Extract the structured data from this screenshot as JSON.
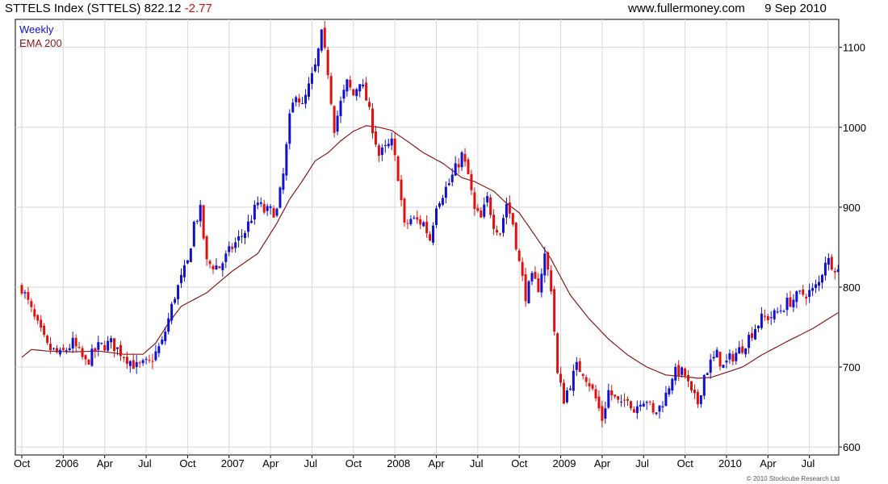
{
  "header": {
    "title": "STTELS Index (STTELS)",
    "last": "822.12",
    "change": "-2.77",
    "site": "www.fullermoney.com",
    "date": "9 Sep 2010"
  },
  "legend": {
    "weekly": "Weekly",
    "ema": "EMA 200"
  },
  "copyright": "© 2010 Stockcube Research Ltd",
  "colors": {
    "up": "#1010d0",
    "down": "#e01010",
    "ema": "#8b1a1a",
    "grid": "#d8d8d8",
    "header_change": "#d01010"
  },
  "chart_data": {
    "type": "line",
    "title": "STTELS Index (STTELS)",
    "frequency": "Weekly",
    "ylim": [
      590,
      1135
    ],
    "grid": true,
    "y_axis_position": "right",
    "yticks": [
      600,
      700,
      800,
      900,
      1000,
      1100
    ],
    "ytick_labels": [
      "600",
      "700",
      "800",
      "900",
      "1000",
      "1100"
    ],
    "xticks": [
      {
        "label": "Oct",
        "week": 0
      },
      {
        "label": "2006",
        "week": 13
      },
      {
        "label": "Apr",
        "week": 26
      },
      {
        "label": "Jul",
        "week": 39
      },
      {
        "label": "Oct",
        "week": 52
      },
      {
        "label": "2007",
        "week": 65
      },
      {
        "label": "Apr",
        "week": 78
      },
      {
        "label": "Jul",
        "week": 91
      },
      {
        "label": "Oct",
        "week": 104
      },
      {
        "label": "2008",
        "week": 117
      },
      {
        "label": "Apr",
        "week": 130
      },
      {
        "label": "Jul",
        "week": 143
      },
      {
        "label": "Oct",
        "week": 156
      },
      {
        "label": "2009",
        "week": 169
      },
      {
        "label": "Apr",
        "week": 182
      },
      {
        "label": "Jul",
        "week": 195
      },
      {
        "label": "Oct",
        "week": 208
      },
      {
        "label": "2010",
        "week": 221
      },
      {
        "label": "Apr",
        "week": 234
      },
      {
        "label": "Jul",
        "week": 247
      }
    ],
    "week_count": 256,
    "price_keypoints": [
      [
        0,
        800
      ],
      [
        4,
        760
      ],
      [
        8,
        725
      ],
      [
        12,
        715
      ],
      [
        16,
        730
      ],
      [
        20,
        705
      ],
      [
        24,
        725
      ],
      [
        28,
        730
      ],
      [
        32,
        715
      ],
      [
        36,
        700
      ],
      [
        40,
        705
      ],
      [
        44,
        730
      ],
      [
        48,
        790
      ],
      [
        52,
        830
      ],
      [
        54,
        880
      ],
      [
        56,
        895
      ],
      [
        58,
        830
      ],
      [
        62,
        825
      ],
      [
        66,
        850
      ],
      [
        70,
        870
      ],
      [
        74,
        905
      ],
      [
        76,
        895
      ],
      [
        80,
        895
      ],
      [
        82,
        940
      ],
      [
        84,
        1010
      ],
      [
        86,
        1045
      ],
      [
        88,
        1025
      ],
      [
        90,
        1050
      ],
      [
        92,
        1075
      ],
      [
        94,
        1115
      ],
      [
        96,
        1070
      ],
      [
        98,
        1000
      ],
      [
        100,
        1030
      ],
      [
        102,
        1055
      ],
      [
        104,
        1040
      ],
      [
        106,
        1060
      ],
      [
        108,
        1035
      ],
      [
        110,
        1000
      ],
      [
        112,
        965
      ],
      [
        116,
        980
      ],
      [
        118,
        940
      ],
      [
        120,
        875
      ],
      [
        122,
        885
      ],
      [
        126,
        880
      ],
      [
        128,
        860
      ],
      [
        130,
        905
      ],
      [
        134,
        930
      ],
      [
        138,
        965
      ],
      [
        140,
        940
      ],
      [
        142,
        895
      ],
      [
        144,
        885
      ],
      [
        146,
        910
      ],
      [
        148,
        880
      ],
      [
        150,
        870
      ],
      [
        152,
        905
      ],
      [
        154,
        880
      ],
      [
        156,
        830
      ],
      [
        158,
        790
      ],
      [
        160,
        810
      ],
      [
        162,
        800
      ],
      [
        164,
        840
      ],
      [
        166,
        800
      ],
      [
        168,
        690
      ],
      [
        170,
        660
      ],
      [
        172,
        680
      ],
      [
        174,
        700
      ],
      [
        176,
        695
      ],
      [
        178,
        680
      ],
      [
        180,
        660
      ],
      [
        182,
        635
      ],
      [
        184,
        670
      ],
      [
        186,
        660
      ],
      [
        188,
        650
      ],
      [
        190,
        665
      ],
      [
        192,
        645
      ],
      [
        194,
        660
      ],
      [
        196,
        660
      ],
      [
        198,
        640
      ],
      [
        200,
        650
      ],
      [
        202,
        665
      ],
      [
        204,
        690
      ],
      [
        206,
        695
      ],
      [
        208,
        690
      ],
      [
        210,
        665
      ],
      [
        212,
        655
      ],
      [
        214,
        690
      ],
      [
        216,
        705
      ],
      [
        218,
        715
      ],
      [
        220,
        700
      ],
      [
        222,
        710
      ],
      [
        226,
        725
      ],
      [
        230,
        750
      ],
      [
        232,
        760
      ],
      [
        236,
        765
      ],
      [
        240,
        780
      ],
      [
        244,
        790
      ],
      [
        248,
        795
      ],
      [
        250,
        805
      ],
      [
        252,
        835
      ],
      [
        254,
        830
      ],
      [
        256,
        822.12
      ]
    ],
    "ema_keypoints": [
      [
        0,
        712
      ],
      [
        3,
        722
      ],
      [
        8,
        720
      ],
      [
        16,
        719
      ],
      [
        24,
        720
      ],
      [
        32,
        716
      ],
      [
        38,
        716
      ],
      [
        42,
        730
      ],
      [
        46,
        755
      ],
      [
        50,
        776
      ],
      [
        58,
        793
      ],
      [
        66,
        820
      ],
      [
        74,
        842
      ],
      [
        80,
        880
      ],
      [
        84,
        910
      ],
      [
        88,
        933
      ],
      [
        92,
        958
      ],
      [
        96,
        968
      ],
      [
        100,
        983
      ],
      [
        104,
        995
      ],
      [
        108,
        1002
      ],
      [
        112,
        1000
      ],
      [
        116,
        996
      ],
      [
        120,
        985
      ],
      [
        126,
        968
      ],
      [
        132,
        955
      ],
      [
        138,
        937
      ],
      [
        142,
        932
      ],
      [
        148,
        920
      ],
      [
        152,
        905
      ],
      [
        156,
        893
      ],
      [
        160,
        870
      ],
      [
        166,
        835
      ],
      [
        172,
        790
      ],
      [
        178,
        760
      ],
      [
        184,
        735
      ],
      [
        190,
        715
      ],
      [
        196,
        700
      ],
      [
        202,
        690
      ],
      [
        208,
        688
      ],
      [
        212,
        686
      ],
      [
        216,
        687
      ],
      [
        220,
        692
      ],
      [
        226,
        700
      ],
      [
        232,
        715
      ],
      [
        240,
        732
      ],
      [
        248,
        748
      ],
      [
        256,
        768
      ]
    ]
  }
}
